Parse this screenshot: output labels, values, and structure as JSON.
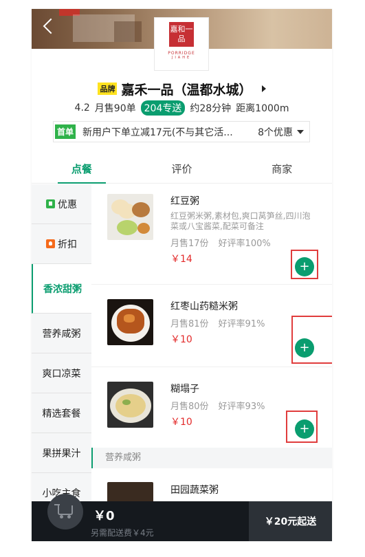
{
  "shop": {
    "brand_badge": "品牌",
    "name": "嘉禾一品（温都水城）",
    "logo_cn": "嘉和一品",
    "logo_en1": "PORRIDGE",
    "logo_en2": "JIAHE",
    "rating": "4.2",
    "monthly_sales": "月售90单",
    "delivery": "204专送",
    "time": "约28分钟",
    "distance": "距离1000m"
  },
  "promo": {
    "tag": "首单",
    "text": "新用户下单立减17元(不与其它活...",
    "count": "8个优惠"
  },
  "tabs": [
    {
      "label": "点餐",
      "active": true
    },
    {
      "label": "评价",
      "active": false
    },
    {
      "label": "商家",
      "active": false
    }
  ],
  "sidebar": {
    "items": [
      {
        "label": "优惠",
        "icon": "coupon-icon"
      },
      {
        "label": "折扣",
        "icon": "discount-icon"
      },
      {
        "label": "香浓甜粥",
        "active": true
      },
      {
        "label": "营养咸粥"
      },
      {
        "label": "爽口凉菜"
      },
      {
        "label": "精选套餐"
      },
      {
        "label": "果拼果汁"
      },
      {
        "label": "小吃主食"
      }
    ]
  },
  "products": [
    {
      "name": "红豆粥",
      "desc": "红豆粥米粥,素材包,爽口莴笋丝,四川泡菜或八宝酱菜,配菜可备注",
      "sales": "月售17份",
      "rating": "好评率100%",
      "price": "￥14"
    },
    {
      "name": "红枣山药糙米粥",
      "sales": "月售81份",
      "rating": "好评率91%",
      "price": "￥10"
    },
    {
      "name": "糊塌子",
      "sales": "月售80份",
      "rating": "好评率93%",
      "price": "￥10"
    },
    {
      "name": "田园蔬菜粥"
    }
  ],
  "section_header": "营养咸粥",
  "add_label": "+",
  "cart": {
    "total": "￥0",
    "fee": "另需配送费￥4元",
    "checkout": "￥20元起送"
  },
  "colors": {
    "accent": "#0a9d6f",
    "price": "#e32b2b",
    "highlight": "#e03c3c"
  }
}
